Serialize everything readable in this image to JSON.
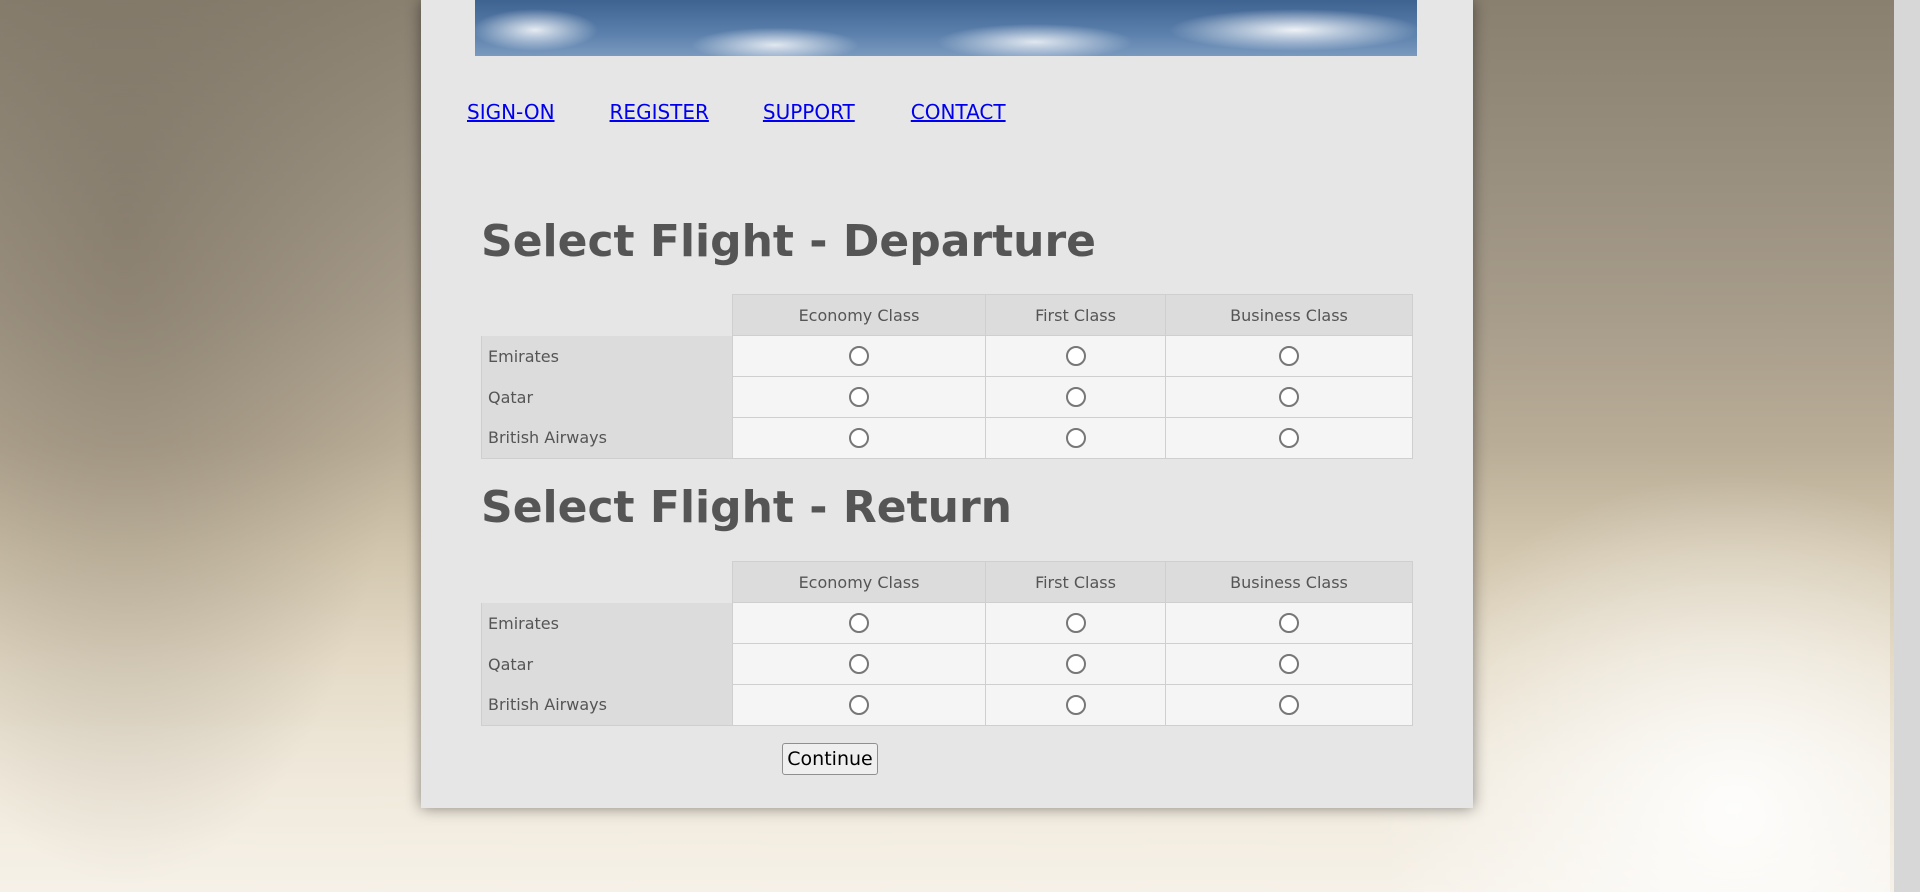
{
  "nav": {
    "sign_on": "SIGN-ON",
    "register": "REGISTER",
    "support": "SUPPORT",
    "contact": "CONTACT"
  },
  "departure": {
    "title": "Select Flight - Departure",
    "columns": [
      "Economy Class",
      "First Class",
      "Business Class"
    ],
    "airlines": [
      "Emirates",
      "Qatar",
      "British Airways"
    ]
  },
  "return": {
    "title": "Select Flight - Return",
    "columns": [
      "Economy Class",
      "First Class",
      "Business Class"
    ],
    "airlines": [
      "Emirates",
      "Qatar",
      "British Airways"
    ]
  },
  "continue_label": "Continue"
}
